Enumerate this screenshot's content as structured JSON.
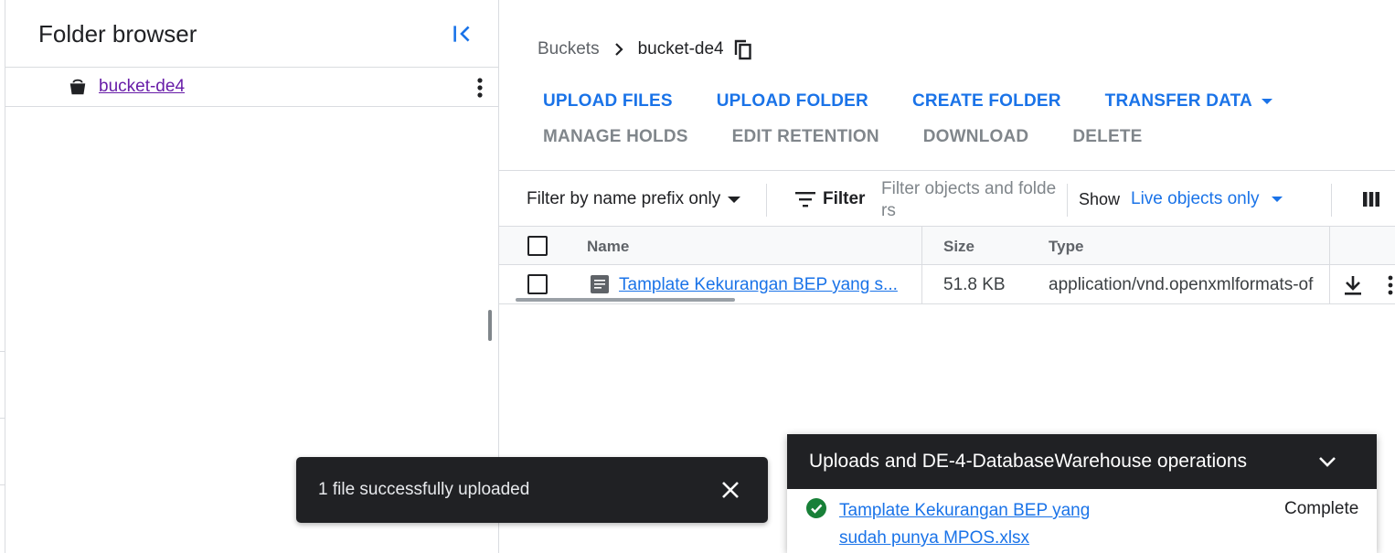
{
  "folder_browser": {
    "title": "Folder browser",
    "bucket_name": "bucket-de4"
  },
  "breadcrumb": {
    "root": "Buckets",
    "current": "bucket-de4"
  },
  "actions": {
    "upload_files": "UPLOAD FILES",
    "upload_folder": "UPLOAD FOLDER",
    "create_folder": "CREATE FOLDER",
    "transfer_data": "TRANSFER DATA",
    "manage_holds": "MANAGE HOLDS",
    "edit_retention": "EDIT RETENTION",
    "download": "DOWNLOAD",
    "delete": "DELETE"
  },
  "filter": {
    "mode": "Filter by name prefix only",
    "label": "Filter",
    "placeholder": "Filter objects and folders",
    "show_label": "Show",
    "show_value": "Live objects only"
  },
  "table": {
    "headers": {
      "name": "Name",
      "size": "Size",
      "type": "Type"
    },
    "rows": [
      {
        "name": "Tamplate Kekurangan BEP yang s...",
        "size": "51.8 KB",
        "type": "application/vnd.openxmlformats-of"
      }
    ]
  },
  "snackbar": {
    "message": "1 file successfully uploaded"
  },
  "uploads": {
    "title": "Uploads and DE-4-DatabaseWarehouse operations",
    "file_name": "Tamplate Kekurangan BEP yang sudah punya MPOS.xlsx",
    "status": "Complete"
  },
  "colors": {
    "accent": "#1a73e8",
    "visited_link": "#681da8",
    "success": "#188038",
    "dark_surface": "#202124"
  }
}
